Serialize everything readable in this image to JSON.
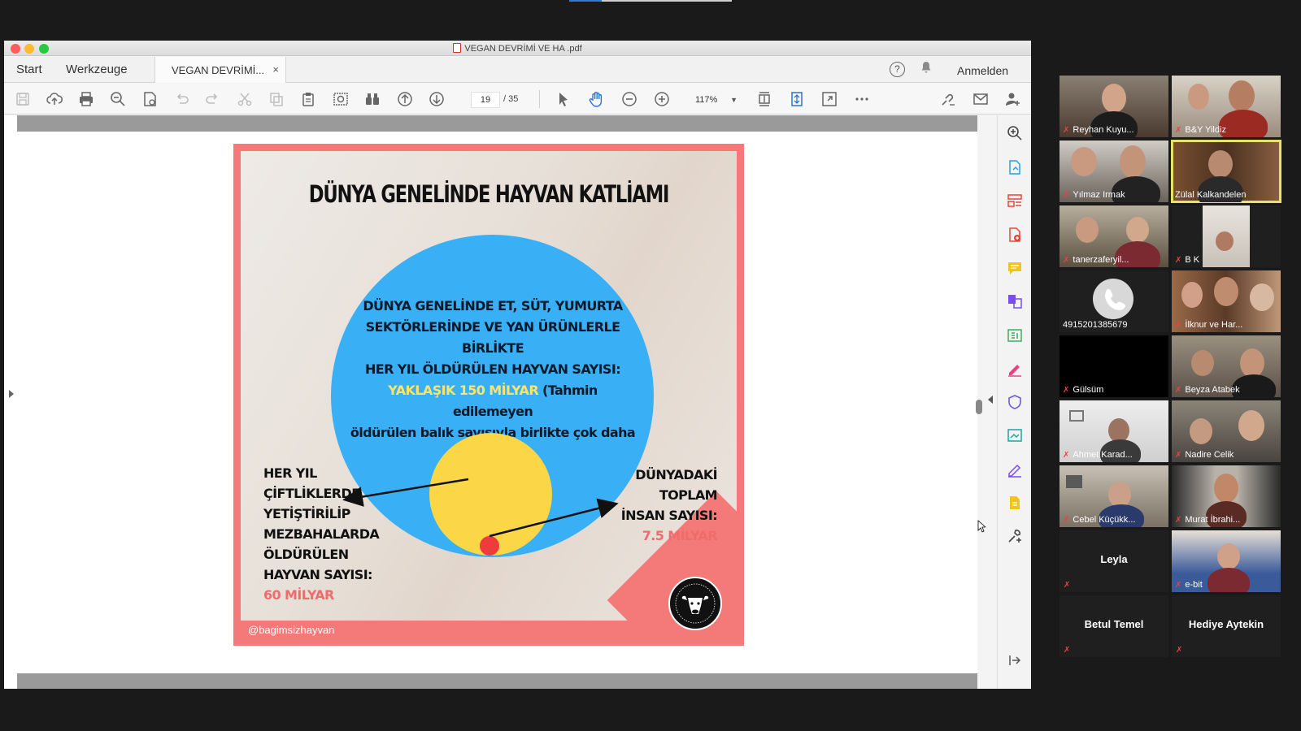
{
  "window": {
    "title": "VEGAN DEVRİMİ VE HA .pdf"
  },
  "tabs": {
    "start": "Start",
    "tools": "Werkzeuge",
    "document": "VEGAN DEVRİMİ...",
    "close": "×",
    "help": "?",
    "signin": "Anmelden"
  },
  "toolbar": {
    "page_current": "19",
    "page_total": "/  35",
    "zoom": "117%"
  },
  "slide": {
    "title": "DÜNYA GENELİNDE HAYVAN KATLİAMI",
    "big_text_lines": [
      "DÜNYA GENELİNDE ET, SÜT, YUMURTA",
      "SEKTÖRLERİNDE VE YAN ÜRÜNLERLE BİRLİKTE",
      "HER YIL ÖLDÜRÜLEN HAYVAN SAYISI:"
    ],
    "big_highlight": "YAKLAŞIK 150 MİLYAR",
    "big_note_1": " (Tahmin edilemeyen",
    "big_note_2": "öldürülen balık sayısıyla birlikte çok daha fazla)",
    "left_lines": [
      "HER YIL",
      "ÇİFTLİKLERDE",
      "YETİŞTİRİLİP",
      "MEZBAHALARDA",
      "ÖLDÜRÜLEN",
      "HAYVAN SAYISI:"
    ],
    "left_value": "60 MİLYAR",
    "right_lines": [
      "DÜNYADAKİ",
      "TOPLAM",
      "İNSAN SAYISI:"
    ],
    "right_value": "7.5 MİLYAR",
    "handle": "@bagimsizhayvan",
    "colors": {
      "frame": "#f47a7a",
      "big_circle": "#39b0f5",
      "small_circle": "#fbd646",
      "dot": "#ee3b3b"
    }
  },
  "participants": [
    {
      "name": "Reyhan Kuyu..."
    },
    {
      "name": "B&Y Yildiz"
    },
    {
      "name": "Yılmaz Irmak"
    },
    {
      "name": "Zülal Kalkandelen"
    },
    {
      "name": "tanerzaferyil..."
    },
    {
      "name": "B K"
    },
    {
      "name": "4915201385679"
    },
    {
      "name": "İlknur ve Har..."
    },
    {
      "name": "Gülsüm"
    },
    {
      "name": "Beyza Atabek"
    },
    {
      "name": "Ahmet Karad..."
    },
    {
      "name": "Nadire Celik"
    },
    {
      "name": "Cebel Küçükk..."
    },
    {
      "name": "Murat İbrahi..."
    },
    {
      "name": "Leyla"
    },
    {
      "name": "e-bit"
    },
    {
      "name": "Betul Temel"
    },
    {
      "name": "Hediye Aytekin"
    }
  ]
}
